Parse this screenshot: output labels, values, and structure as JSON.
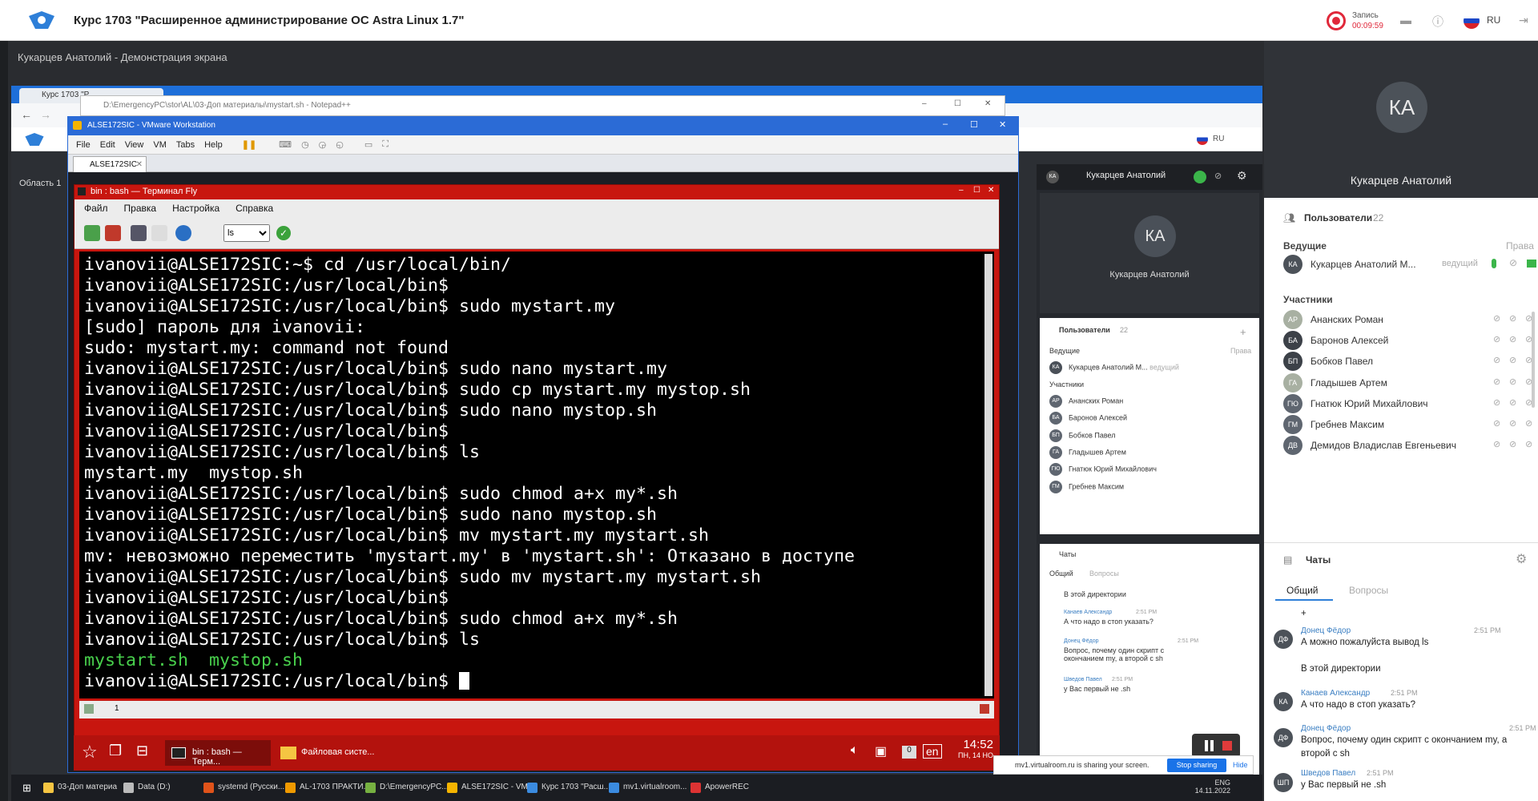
{
  "app": {
    "course_title": "Курс 1703 \"Расширенное администрирование ОС Astra Linux 1.7\"",
    "record_label": "Запись",
    "record_time": "00:09:59",
    "lang": "RU"
  },
  "share": {
    "title": "Кукарцев Анатолий - Демонстрация экрана"
  },
  "browser": {
    "tab_label": "Курс 1703 \"Р",
    "area_label": "Область 1"
  },
  "notepad": {
    "title": "D:\\EmergencyPC\\stor\\AL\\03-Доп материалы\\mystart.sh - Notepad++"
  },
  "vmware": {
    "title": "ALSE172SIC - VMware Workstation",
    "menu": [
      "File",
      "Edit",
      "View",
      "VM",
      "Tabs",
      "Help"
    ],
    "tab": "ALSE172SIC"
  },
  "terminal": {
    "title": "bin : bash — Терминал Fly",
    "menu": [
      "Файл",
      "Правка",
      "Настройка",
      "Справка"
    ],
    "combo_value": "ls",
    "tab_number": "1",
    "lines": [
      {
        "text": "ivanovii@ALSE172SIC:~$ cd /usr/local/bin/",
        "green": false
      },
      {
        "text": "ivanovii@ALSE172SIC:/usr/local/bin$",
        "green": false
      },
      {
        "text": "ivanovii@ALSE172SIC:/usr/local/bin$ sudo mystart.my",
        "green": false
      },
      {
        "text": "[sudo] пароль для ivanovii:",
        "green": false
      },
      {
        "text": "sudo: mystart.my: command not found",
        "green": false
      },
      {
        "text": "ivanovii@ALSE172SIC:/usr/local/bin$ sudo nano mystart.my",
        "green": false
      },
      {
        "text": "ivanovii@ALSE172SIC:/usr/local/bin$ sudo cp mystart.my mystop.sh",
        "green": false
      },
      {
        "text": "ivanovii@ALSE172SIC:/usr/local/bin$ sudo nano mystop.sh",
        "green": false
      },
      {
        "text": "ivanovii@ALSE172SIC:/usr/local/bin$",
        "green": false
      },
      {
        "text": "ivanovii@ALSE172SIC:/usr/local/bin$ ls",
        "green": false
      },
      {
        "text": "mystart.my  mystop.sh",
        "green": false
      },
      {
        "text": "ivanovii@ALSE172SIC:/usr/local/bin$ sudo chmod a+x my*.sh",
        "green": false
      },
      {
        "text": "ivanovii@ALSE172SIC:/usr/local/bin$ sudo nano mystop.sh",
        "green": false
      },
      {
        "text": "ivanovii@ALSE172SIC:/usr/local/bin$ mv mystart.my mystart.sh",
        "green": false
      },
      {
        "text": "mv: невозможно переместить 'mystart.my' в 'mystart.sh': Отказано в доступе",
        "green": false
      },
      {
        "text": "ivanovii@ALSE172SIC:/usr/local/bin$ sudo mv mystart.my mystart.sh",
        "green": false
      },
      {
        "text": "ivanovii@ALSE172SIC:/usr/local/bin$",
        "green": false
      },
      {
        "text": "ivanovii@ALSE172SIC:/usr/local/bin$ sudo chmod a+x my*.sh",
        "green": false
      },
      {
        "text": "ivanovii@ALSE172SIC:/usr/local/bin$ ls",
        "green": false
      },
      {
        "text": "mystart.sh  mystop.sh",
        "green": true
      }
    ],
    "prompt": "ivanovii@ALSE172SIC:/usr/local/bin$ "
  },
  "guest_taskbar": {
    "item1": "bin : bash — Терм...",
    "item2": "Файловая систе...",
    "zero": "0",
    "lang": "en",
    "time": "14:52",
    "date": "ПН, 14 НО"
  },
  "mini_vc": {
    "header_name": "Кукарцев Анатолий",
    "avatar": "КА",
    "video_name": "Кукарцев Анатолий",
    "users_title": "Пользователи",
    "users_count": "22",
    "hosts": "Ведущие",
    "rights": "Права",
    "host_name": "Кукарцев Анатолий М...",
    "host_role": "ведущий",
    "participants": "Участники",
    "people": [
      {
        "initials": "АР",
        "name": "Ананских Роман"
      },
      {
        "initials": "БА",
        "name": "Баронов Алексей"
      },
      {
        "initials": "БП",
        "name": "Бобков Павел"
      },
      {
        "initials": "ГА",
        "name": "Гладышев Артем"
      },
      {
        "initials": "ГЮ",
        "name": "Гнатюк Юрий Михайлович"
      },
      {
        "initials": "ГМ",
        "name": "Гребнев Максим"
      }
    ],
    "chats": "Чаты",
    "tab_general": "Общий",
    "tab_questions": "Вопросы",
    "msg0": "В этой директории",
    "msg1_author": "Канаев Александр",
    "msg1_time": "2:51 PM",
    "msg1_text": "А что надо в стоп указать?",
    "msg2_author": "Донец Фёдор",
    "msg2_time": "2:51 PM",
    "msg2_text": "Вопрос, почему один скрипт с окончанием my, а второй с sh",
    "msg3_author": "Шведов Павел",
    "msg3_time": "2:51 PM",
    "msg3_text": "у Вас первый не .sh"
  },
  "share_banner": {
    "text": "mv1.virtualroom.ru is sharing your screen.",
    "stop": "Stop sharing",
    "hide": "Hide"
  },
  "host_taskbar": {
    "items": [
      "03-Доп материа",
      "Data (D:)",
      "systemd (Русски...",
      "AL-1703 ПРАКТИ...",
      "D:\\EmergencyPC...",
      "ALSE172SIC - VM...",
      "Курс 1703 \"Расш...",
      "mv1.virtualroom...",
      "ApowerREC"
    ],
    "lang": "ENG",
    "date": "14.11.2022"
  },
  "sidebar": {
    "avatar": "КА",
    "video_name": "Кукарцев Анатолий",
    "users_title": "Пользователи",
    "users_count": "22",
    "hosts": "Ведущие",
    "rights": "Права",
    "host_initials": "КА",
    "host_name": "Кукарцев Анатолий М...",
    "host_role": "ведущий",
    "participants": "Участники",
    "people": [
      {
        "initials": "АР",
        "name": "Ананских Роман",
        "color": "#a8b0a2"
      },
      {
        "initials": "БА",
        "name": "Баронов Алексей",
        "color": "#3c4148"
      },
      {
        "initials": "БП",
        "name": "Бобков Павел",
        "color": "#3c4148"
      },
      {
        "initials": "ГА",
        "name": "Гладышев Артем",
        "color": "#a8b0a2"
      },
      {
        "initials": "ГЮ",
        "name": "Гнатюк Юрий Михайлович",
        "color": "#5f6670"
      },
      {
        "initials": "ГМ",
        "name": "Гребнев Максим",
        "color": "#5f6670"
      },
      {
        "initials": "ДВ",
        "name": "Демидов Владислав Евгеньевич",
        "color": "#5f6670"
      }
    ],
    "chats": "Чаты",
    "tab_general": "Общий",
    "tab_questions": "Вопросы",
    "msg0_text": "+",
    "msg1_initials": "ДФ",
    "msg1_author": "Донец Фёдор",
    "msg1_time": "2:51 PM",
    "msg1_text": "А можно пожалуйста вывод ls",
    "msg1b_text": "В этой директории",
    "msg2_initials": "КА",
    "msg2_author": "Канаев Александр",
    "msg2_time": "2:51 PM",
    "msg2_text": "А что надо в стоп указать?",
    "msg3_initials": "ДФ",
    "msg3_author": "Донец Фёдор",
    "msg3_time": "2:51 PM",
    "msg3_text": "Вопрос, почему один скрипт с окончанием my, а второй с sh",
    "msg4_initials": "ШП",
    "msg4_author": "Шведов Павел",
    "msg4_time": "2:51 PM",
    "msg4_text": "у Вас первый не .sh"
  },
  "colors": {
    "terminal_red": "#c8160f",
    "vmware_blue": "#2b6bd6",
    "prompt_green": "#48d04c",
    "record_red": "#e0283a"
  }
}
